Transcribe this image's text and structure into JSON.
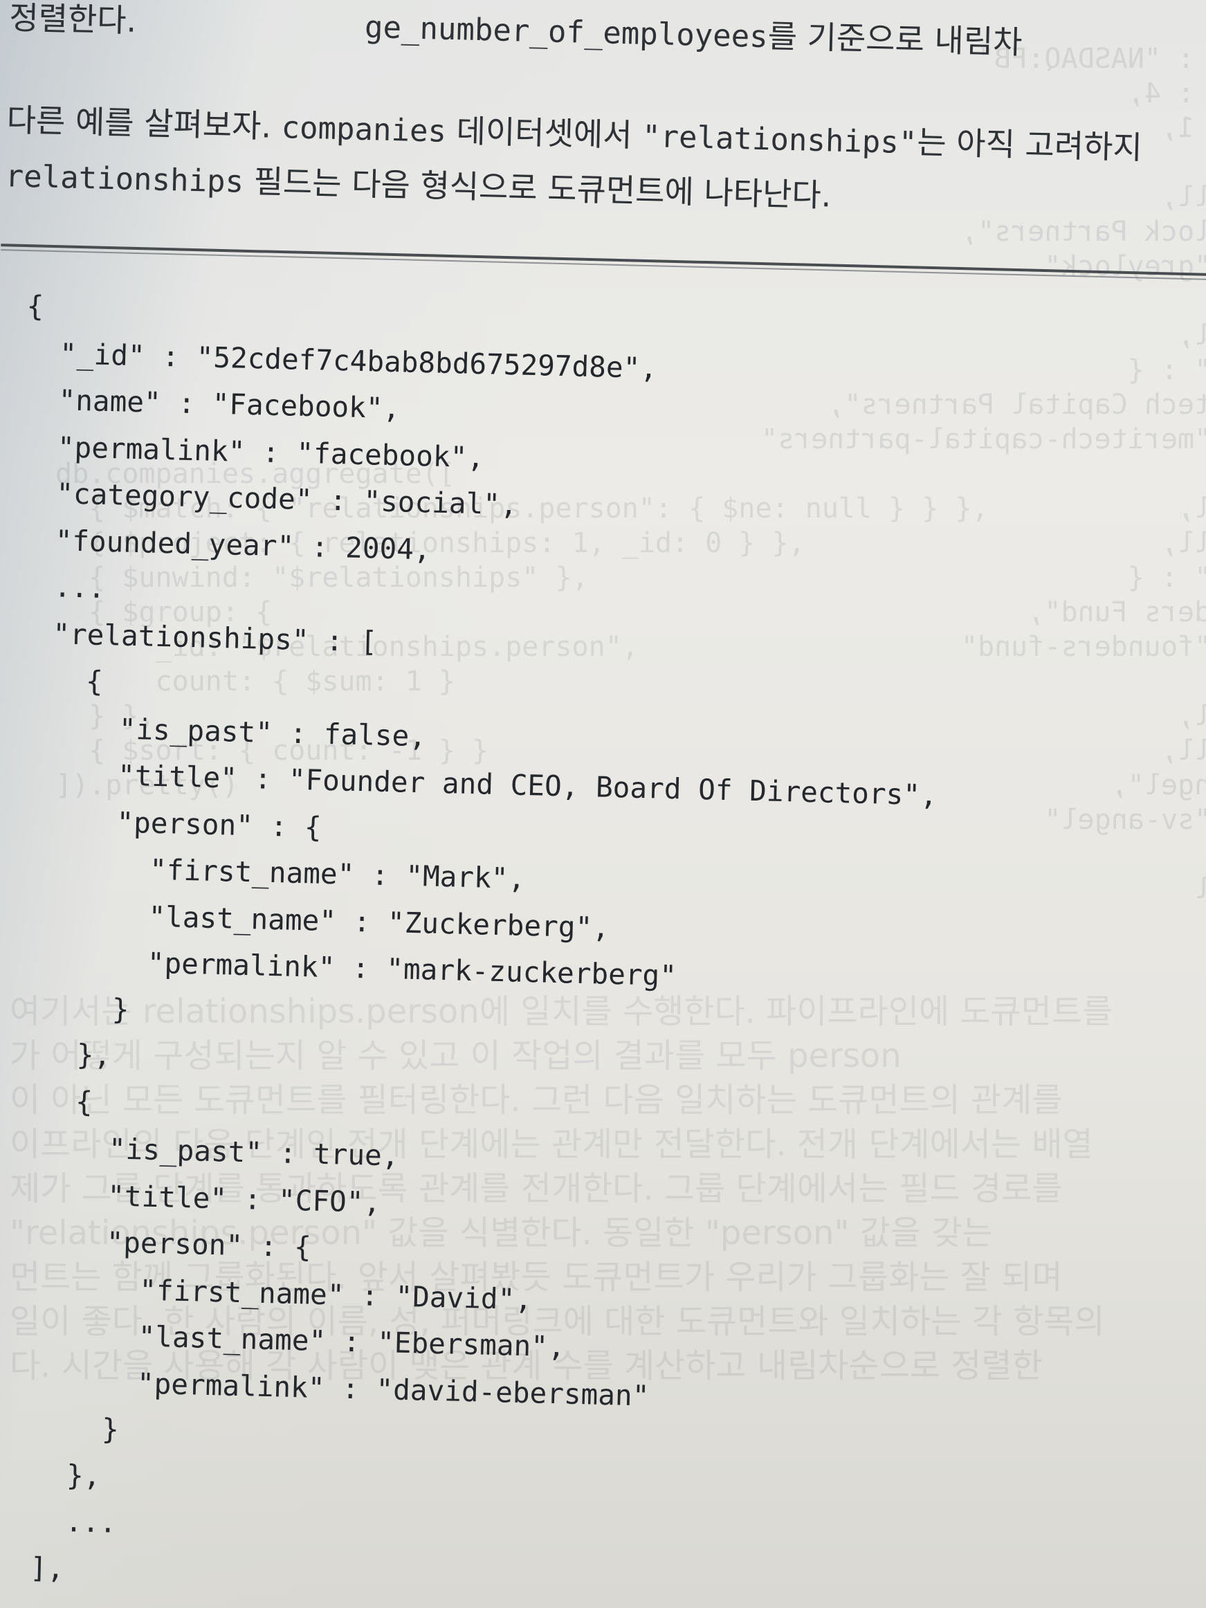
{
  "prose": {
    "line1_a": "정렬한다.",
    "line1_b": "ge_number_of_employees",
    "line1_c": "를 기준으로 내림차",
    "line2_a": "다른 예를 살펴보자.",
    "line2_b": "companies",
    "line2_c": "데이터셋에서",
    "line2_d": "\"relationships\"",
    "line2_e": "는 아직 고려하지",
    "line3_a": "relationships",
    "line3_b": "필드는 다음 형식으로 도큐먼트에 나타난다."
  },
  "code": {
    "lines": [
      "  {",
      "    \"_id\" : \"52cdef7c4bab8bd675297d8e\",",
      "    \"name\" : \"Facebook\",",
      "    \"permalink\" : \"facebook\",",
      "    \"category_code\" : \"social\",",
      "    \"founded_year\" : 2004,",
      "    ...",
      "    \"relationships\" : [",
      "      {",
      "        \"is_past\" : false,",
      "        \"title\" : \"Founder and CEO, Board Of Directors\",",
      "        \"person\" : {",
      "          \"first_name\" : \"Mark\",",
      "          \"last_name\" : \"Zuckerberg\",",
      "          \"permalink\" : \"mark-zuckerberg\"",
      "        }",
      "      },",
      "      {",
      "        \"is_past\" : true,",
      "        \"title\" : \"CFO\",",
      "        \"person\" : {",
      "          \"first_name\" : \"David\",",
      "          \"last_name\" : \"Ebersman\",",
      "          \"permalink\" : \"david-ebersman\"",
      "        }",
      "      },",
      "      ...",
      "    ],"
    ]
  }
}
